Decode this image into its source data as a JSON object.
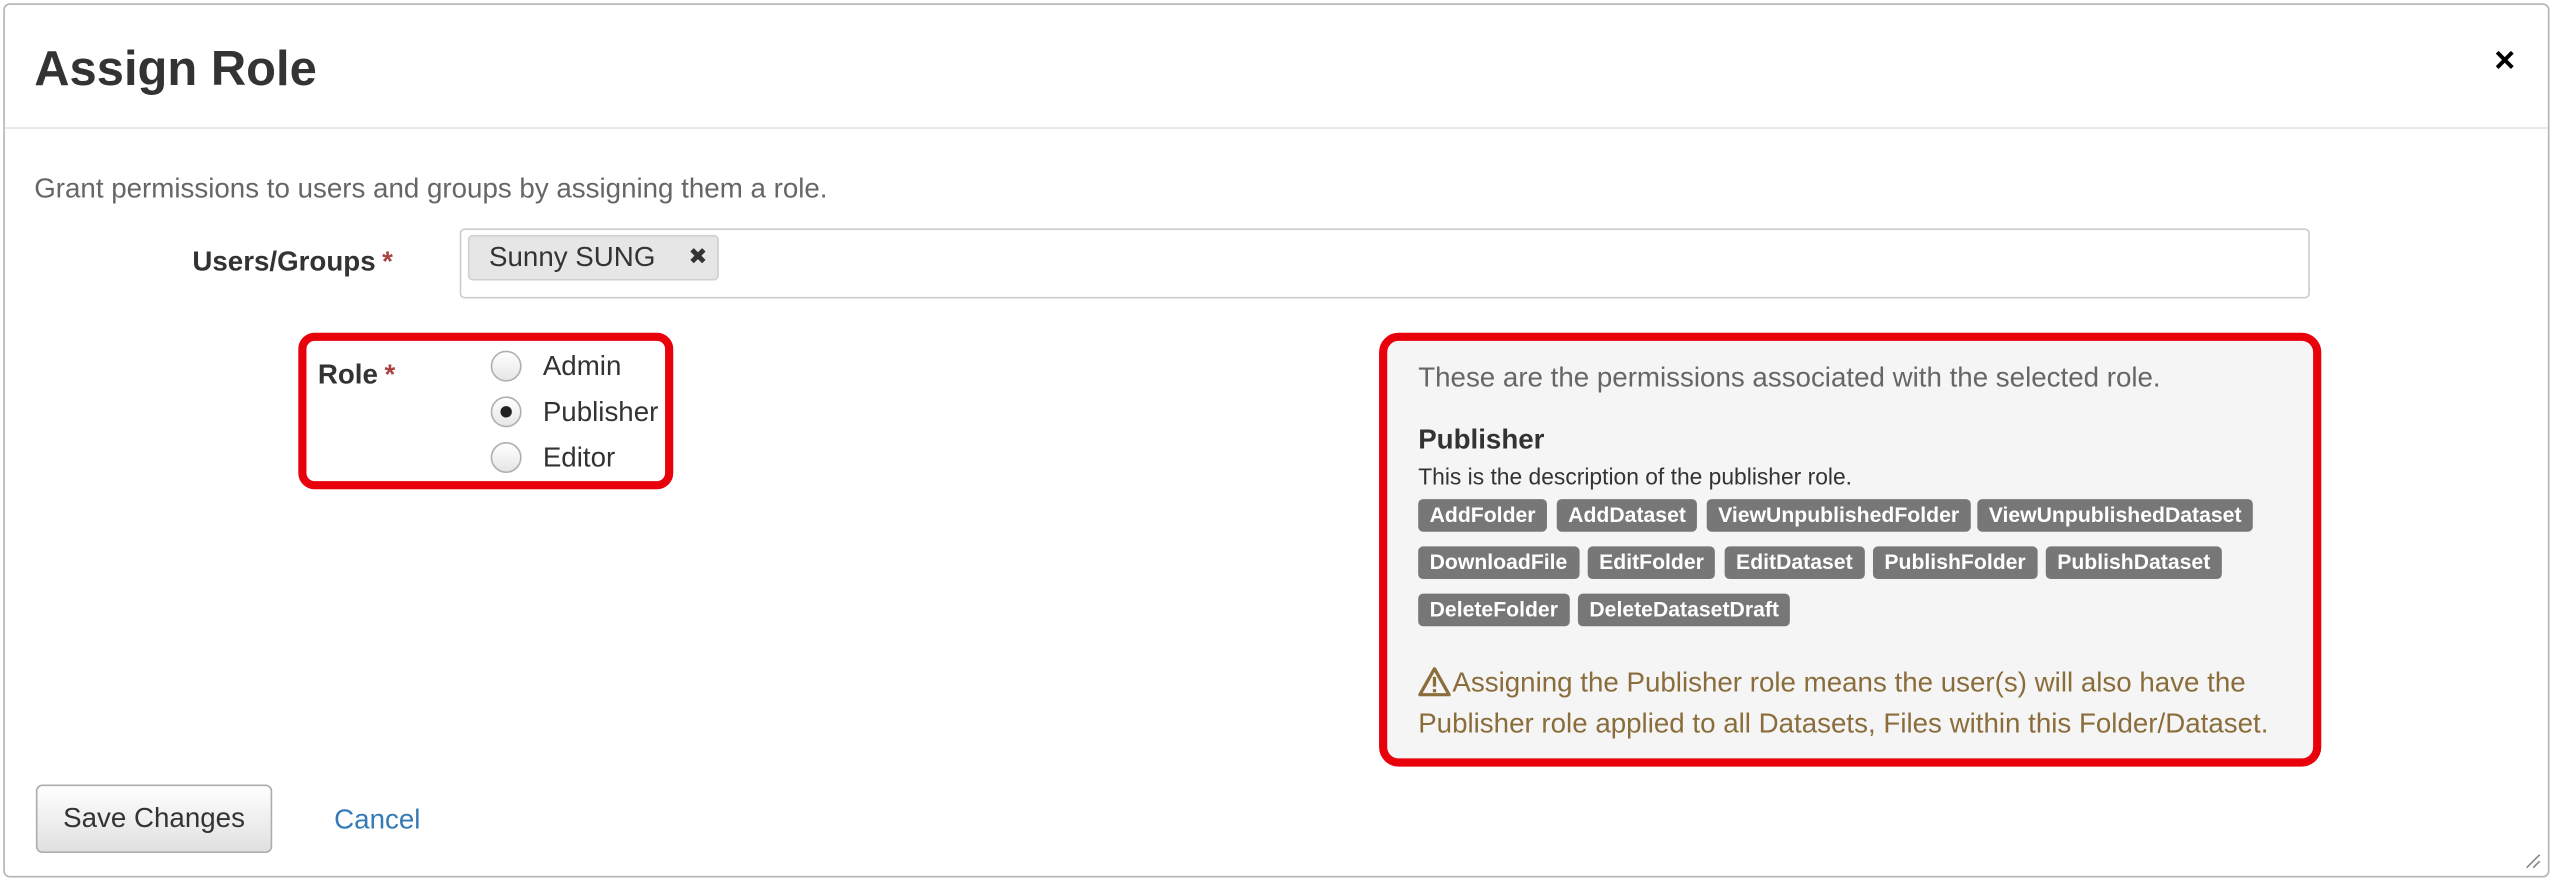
{
  "dialog": {
    "title": "Assign Role",
    "close_label": "×"
  },
  "intro_text": "Grant permissions to users and groups by assigning them a role.",
  "users_field": {
    "label": "Users/Groups",
    "required_mark": "*",
    "tokens": [
      {
        "label": "Sunny SUNG",
        "remove": "✖"
      }
    ]
  },
  "role_field": {
    "label": "Role",
    "required_mark": "*",
    "options": [
      {
        "label": "Admin",
        "selected": false
      },
      {
        "label": "Publisher",
        "selected": true
      },
      {
        "label": "Editor",
        "selected": false
      }
    ]
  },
  "permissions_panel": {
    "intro": "These are the permissions associated with the selected role.",
    "role_name": "Publisher",
    "role_description": "This is the description of the publisher role.",
    "permissions": [
      "AddFolder",
      "AddDataset",
      "ViewUnpublishedFolder",
      "ViewUnpublishedDataset",
      "DownloadFile",
      "EditFolder",
      "EditDataset",
      "PublishFolder",
      "PublishDataset",
      "DeleteFolder",
      "DeleteDatasetDraft"
    ],
    "warning": "Assigning the Publisher role means the user(s) will also have the Publisher role applied to all Datasets, Files within this Folder/Dataset.",
    "warning_icon": "warning-triangle-icon"
  },
  "footer": {
    "save_label": "Save Changes",
    "cancel_label": "Cancel"
  },
  "colors": {
    "highlight_border": "#e8000b",
    "required": "#a94442",
    "link": "#337ab7",
    "warning_text": "#8a6d3b",
    "tag_bg": "#777777"
  }
}
